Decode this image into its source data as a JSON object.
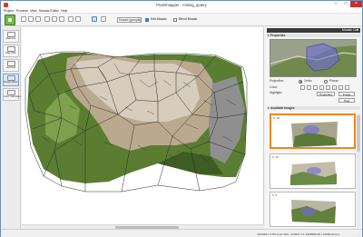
{
  "window": {
    "title": "Pix4Dmapper - mining_quarry",
    "min_glyph": "–",
    "max_glyph": "□",
    "close_glyph": "×"
  },
  "menu": [
    "Project",
    "Process",
    "View",
    "Mosaic Editor",
    "Help"
  ],
  "toolbar": {
    "mosaic_select": "Mosaic (group1)",
    "edit_mosaic_label": "Edit Mosaic",
    "edit_mosaic_checked": true,
    "blend_mosaic_label": "Blend Mosaic",
    "blend_mosaic_checked": false
  },
  "sidebar": [
    {
      "label": "Welcome",
      "icon": "home-icon"
    },
    {
      "label": "Map View",
      "icon": "map-icon"
    },
    {
      "label": "rayCloud",
      "icon": "raycloud-icon"
    },
    {
      "label": "Mosaic Editor",
      "icon": "mosaic-editor-icon",
      "active": true
    },
    {
      "label": "Index Calculator",
      "icon": "index-calculator-icon"
    }
  ],
  "panel": {
    "title": "Mosaic Cell",
    "properties_label": "Properties",
    "projection_label": "Projection:",
    "ortho_label": "Ortho",
    "planar_label": "Planar",
    "color_label": "Color:",
    "highlight_label": "Highlight:",
    "projection_btn": "Projection",
    "image_btn": "Image",
    "help_btn": "Help",
    "available_images_label": "Available Images"
  },
  "images": [
    "0_18",
    "0_12",
    "0_8"
  ],
  "status": {
    "coords": "WGS84 / UTM zone 32N : 373227.71, 5168580.65 | 10000.00 (m)"
  },
  "colors": {
    "accent": "#f0861f",
    "highlight": "#6e6ad8",
    "panel_header": "#3a3a3a"
  }
}
